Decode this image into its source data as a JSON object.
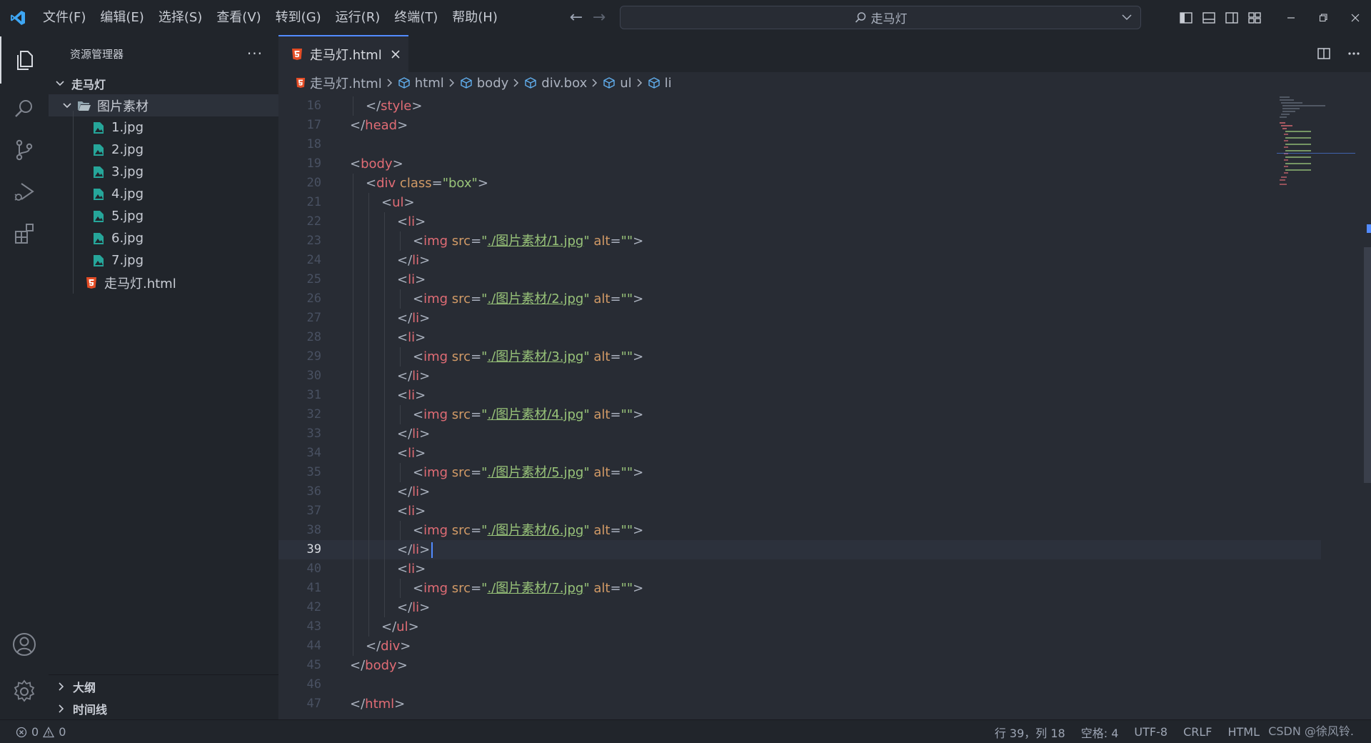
{
  "menu": [
    "文件(F)",
    "编辑(E)",
    "选择(S)",
    "查看(V)",
    "转到(G)",
    "运行(R)",
    "终端(T)",
    "帮助(H)"
  ],
  "command_center": {
    "text": "走马灯"
  },
  "sidebar": {
    "title": "资源管理器",
    "more": "···",
    "root_folder": "走马灯",
    "subfolder": "图片素材",
    "files": [
      "1.jpg",
      "2.jpg",
      "3.jpg",
      "4.jpg",
      "5.jpg",
      "6.jpg",
      "7.jpg"
    ],
    "html_file": "走马灯.html",
    "sections": [
      "大纲",
      "时间线"
    ]
  },
  "tab": {
    "label": "走马灯.html"
  },
  "breadcrumb": [
    "走马灯.html",
    "html",
    "body",
    "div.box",
    "ul",
    "li"
  ],
  "code": {
    "current_line": 39,
    "lines": [
      {
        "n": 16,
        "tokens": [
          [
            "t-punc",
            "</"
          ],
          [
            "t-tag",
            "style"
          ],
          [
            "t-punc",
            ">"
          ]
        ],
        "indent": 1
      },
      {
        "n": 17,
        "tokens": [
          [
            "t-punc",
            "</"
          ],
          [
            "t-tag",
            "head"
          ],
          [
            "t-punc",
            ">"
          ]
        ],
        "indent": 0
      },
      {
        "n": 18,
        "tokens": [],
        "indent": 0
      },
      {
        "n": 19,
        "tokens": [
          [
            "t-punc",
            "<"
          ],
          [
            "t-tag",
            "body"
          ],
          [
            "t-punc",
            ">"
          ]
        ],
        "indent": 0
      },
      {
        "n": 20,
        "tokens": [
          [
            "t-punc",
            "<"
          ],
          [
            "t-tag",
            "div"
          ],
          [
            "t-punc",
            " "
          ],
          [
            "t-attr",
            "class"
          ],
          [
            "t-punc",
            "="
          ],
          [
            "t-str",
            "\"box\""
          ],
          [
            "t-punc",
            ">"
          ]
        ],
        "indent": 1
      },
      {
        "n": 21,
        "tokens": [
          [
            "t-punc",
            "<"
          ],
          [
            "t-tag",
            "ul"
          ],
          [
            "t-punc",
            ">"
          ]
        ],
        "indent": 2
      },
      {
        "n": 22,
        "tokens": [
          [
            "t-punc",
            "<"
          ],
          [
            "t-tag",
            "li"
          ],
          [
            "t-punc",
            ">"
          ]
        ],
        "indent": 3
      },
      {
        "n": 23,
        "tokens": [
          [
            "t-punc",
            "<"
          ],
          [
            "t-tag",
            "img"
          ],
          [
            "t-punc",
            " "
          ],
          [
            "t-attr",
            "src"
          ],
          [
            "t-punc",
            "="
          ],
          [
            "t-str",
            "\""
          ],
          [
            "t-link",
            "./图片素材/1.jpg"
          ],
          [
            "t-str",
            "\""
          ],
          [
            "t-punc",
            " "
          ],
          [
            "t-attr",
            "alt"
          ],
          [
            "t-punc",
            "="
          ],
          [
            "t-str",
            "\"\""
          ],
          [
            "t-punc",
            ">"
          ]
        ],
        "indent": 4
      },
      {
        "n": 24,
        "tokens": [
          [
            "t-punc",
            "</"
          ],
          [
            "t-tag",
            "li"
          ],
          [
            "t-punc",
            ">"
          ]
        ],
        "indent": 3
      },
      {
        "n": 25,
        "tokens": [
          [
            "t-punc",
            "<"
          ],
          [
            "t-tag",
            "li"
          ],
          [
            "t-punc",
            ">"
          ]
        ],
        "indent": 3
      },
      {
        "n": 26,
        "tokens": [
          [
            "t-punc",
            "<"
          ],
          [
            "t-tag",
            "img"
          ],
          [
            "t-punc",
            " "
          ],
          [
            "t-attr",
            "src"
          ],
          [
            "t-punc",
            "="
          ],
          [
            "t-str",
            "\""
          ],
          [
            "t-link",
            "./图片素材/2.jpg"
          ],
          [
            "t-str",
            "\""
          ],
          [
            "t-punc",
            " "
          ],
          [
            "t-attr",
            "alt"
          ],
          [
            "t-punc",
            "="
          ],
          [
            "t-str",
            "\"\""
          ],
          [
            "t-punc",
            ">"
          ]
        ],
        "indent": 4
      },
      {
        "n": 27,
        "tokens": [
          [
            "t-punc",
            "</"
          ],
          [
            "t-tag",
            "li"
          ],
          [
            "t-punc",
            ">"
          ]
        ],
        "indent": 3
      },
      {
        "n": 28,
        "tokens": [
          [
            "t-punc",
            "<"
          ],
          [
            "t-tag",
            "li"
          ],
          [
            "t-punc",
            ">"
          ]
        ],
        "indent": 3
      },
      {
        "n": 29,
        "tokens": [
          [
            "t-punc",
            "<"
          ],
          [
            "t-tag",
            "img"
          ],
          [
            "t-punc",
            " "
          ],
          [
            "t-attr",
            "src"
          ],
          [
            "t-punc",
            "="
          ],
          [
            "t-str",
            "\""
          ],
          [
            "t-link",
            "./图片素材/3.jpg"
          ],
          [
            "t-str",
            "\""
          ],
          [
            "t-punc",
            " "
          ],
          [
            "t-attr",
            "alt"
          ],
          [
            "t-punc",
            "="
          ],
          [
            "t-str",
            "\"\""
          ],
          [
            "t-punc",
            ">"
          ]
        ],
        "indent": 4
      },
      {
        "n": 30,
        "tokens": [
          [
            "t-punc",
            "</"
          ],
          [
            "t-tag",
            "li"
          ],
          [
            "t-punc",
            ">"
          ]
        ],
        "indent": 3
      },
      {
        "n": 31,
        "tokens": [
          [
            "t-punc",
            "<"
          ],
          [
            "t-tag",
            "li"
          ],
          [
            "t-punc",
            ">"
          ]
        ],
        "indent": 3
      },
      {
        "n": 32,
        "tokens": [
          [
            "t-punc",
            "<"
          ],
          [
            "t-tag",
            "img"
          ],
          [
            "t-punc",
            " "
          ],
          [
            "t-attr",
            "src"
          ],
          [
            "t-punc",
            "="
          ],
          [
            "t-str",
            "\""
          ],
          [
            "t-link",
            "./图片素材/4.jpg"
          ],
          [
            "t-str",
            "\""
          ],
          [
            "t-punc",
            " "
          ],
          [
            "t-attr",
            "alt"
          ],
          [
            "t-punc",
            "="
          ],
          [
            "t-str",
            "\"\""
          ],
          [
            "t-punc",
            ">"
          ]
        ],
        "indent": 4
      },
      {
        "n": 33,
        "tokens": [
          [
            "t-punc",
            "</"
          ],
          [
            "t-tag",
            "li"
          ],
          [
            "t-punc",
            ">"
          ]
        ],
        "indent": 3
      },
      {
        "n": 34,
        "tokens": [
          [
            "t-punc",
            "<"
          ],
          [
            "t-tag",
            "li"
          ],
          [
            "t-punc",
            ">"
          ]
        ],
        "indent": 3
      },
      {
        "n": 35,
        "tokens": [
          [
            "t-punc",
            "<"
          ],
          [
            "t-tag",
            "img"
          ],
          [
            "t-punc",
            " "
          ],
          [
            "t-attr",
            "src"
          ],
          [
            "t-punc",
            "="
          ],
          [
            "t-str",
            "\""
          ],
          [
            "t-link",
            "./图片素材/5.jpg"
          ],
          [
            "t-str",
            "\""
          ],
          [
            "t-punc",
            " "
          ],
          [
            "t-attr",
            "alt"
          ],
          [
            "t-punc",
            "="
          ],
          [
            "t-str",
            "\"\""
          ],
          [
            "t-punc",
            ">"
          ]
        ],
        "indent": 4
      },
      {
        "n": 36,
        "tokens": [
          [
            "t-punc",
            "</"
          ],
          [
            "t-tag",
            "li"
          ],
          [
            "t-punc",
            ">"
          ]
        ],
        "indent": 3
      },
      {
        "n": 37,
        "tokens": [
          [
            "t-punc",
            "<"
          ],
          [
            "t-tag",
            "li"
          ],
          [
            "t-punc",
            ">"
          ]
        ],
        "indent": 3
      },
      {
        "n": 38,
        "tokens": [
          [
            "t-punc",
            "<"
          ],
          [
            "t-tag",
            "img"
          ],
          [
            "t-punc",
            " "
          ],
          [
            "t-attr",
            "src"
          ],
          [
            "t-punc",
            "="
          ],
          [
            "t-str",
            "\""
          ],
          [
            "t-link",
            "./图片素材/6.jpg"
          ],
          [
            "t-str",
            "\""
          ],
          [
            "t-punc",
            " "
          ],
          [
            "t-attr",
            "alt"
          ],
          [
            "t-punc",
            "="
          ],
          [
            "t-str",
            "\"\""
          ],
          [
            "t-punc",
            ">"
          ]
        ],
        "indent": 4
      },
      {
        "n": 39,
        "tokens": [
          [
            "t-punc",
            "</"
          ],
          [
            "t-tag",
            "li"
          ],
          [
            "t-punc",
            ">"
          ]
        ],
        "indent": 3
      },
      {
        "n": 40,
        "tokens": [
          [
            "t-punc",
            "<"
          ],
          [
            "t-tag",
            "li"
          ],
          [
            "t-punc",
            ">"
          ]
        ],
        "indent": 3
      },
      {
        "n": 41,
        "tokens": [
          [
            "t-punc",
            "<"
          ],
          [
            "t-tag",
            "img"
          ],
          [
            "t-punc",
            " "
          ],
          [
            "t-attr",
            "src"
          ],
          [
            "t-punc",
            "="
          ],
          [
            "t-str",
            "\""
          ],
          [
            "t-link",
            "./图片素材/7.jpg"
          ],
          [
            "t-str",
            "\""
          ],
          [
            "t-punc",
            " "
          ],
          [
            "t-attr",
            "alt"
          ],
          [
            "t-punc",
            "="
          ],
          [
            "t-str",
            "\"\""
          ],
          [
            "t-punc",
            ">"
          ]
        ],
        "indent": 4
      },
      {
        "n": 42,
        "tokens": [
          [
            "t-punc",
            "</"
          ],
          [
            "t-tag",
            "li"
          ],
          [
            "t-punc",
            ">"
          ]
        ],
        "indent": 3
      },
      {
        "n": 43,
        "tokens": [
          [
            "t-punc",
            "</"
          ],
          [
            "t-tag",
            "ul"
          ],
          [
            "t-punc",
            ">"
          ]
        ],
        "indent": 2
      },
      {
        "n": 44,
        "tokens": [
          [
            "t-punc",
            "</"
          ],
          [
            "t-tag",
            "div"
          ],
          [
            "t-punc",
            ">"
          ]
        ],
        "indent": 1
      },
      {
        "n": 45,
        "tokens": [
          [
            "t-punc",
            "</"
          ],
          [
            "t-tag",
            "body"
          ],
          [
            "t-punc",
            ">"
          ]
        ],
        "indent": 0
      },
      {
        "n": 46,
        "tokens": [],
        "indent": 0
      },
      {
        "n": 47,
        "tokens": [
          [
            "t-punc",
            "</"
          ],
          [
            "t-tag",
            "html"
          ],
          [
            "t-punc",
            ">"
          ]
        ],
        "indent": 0
      }
    ]
  },
  "status": {
    "errors": "0",
    "warnings": "0",
    "position": "行 39，列 18",
    "spaces": "空格: 4",
    "encoding": "UTF-8",
    "eol": "CRLF",
    "language": "HTML"
  },
  "watermark": "CSDN @徐风铃.",
  "colors": {
    "accent": "#528bff",
    "html_icon": "#e44d26",
    "image_icon": "#26a69a",
    "breadcrumb_icon": "#61afef"
  }
}
